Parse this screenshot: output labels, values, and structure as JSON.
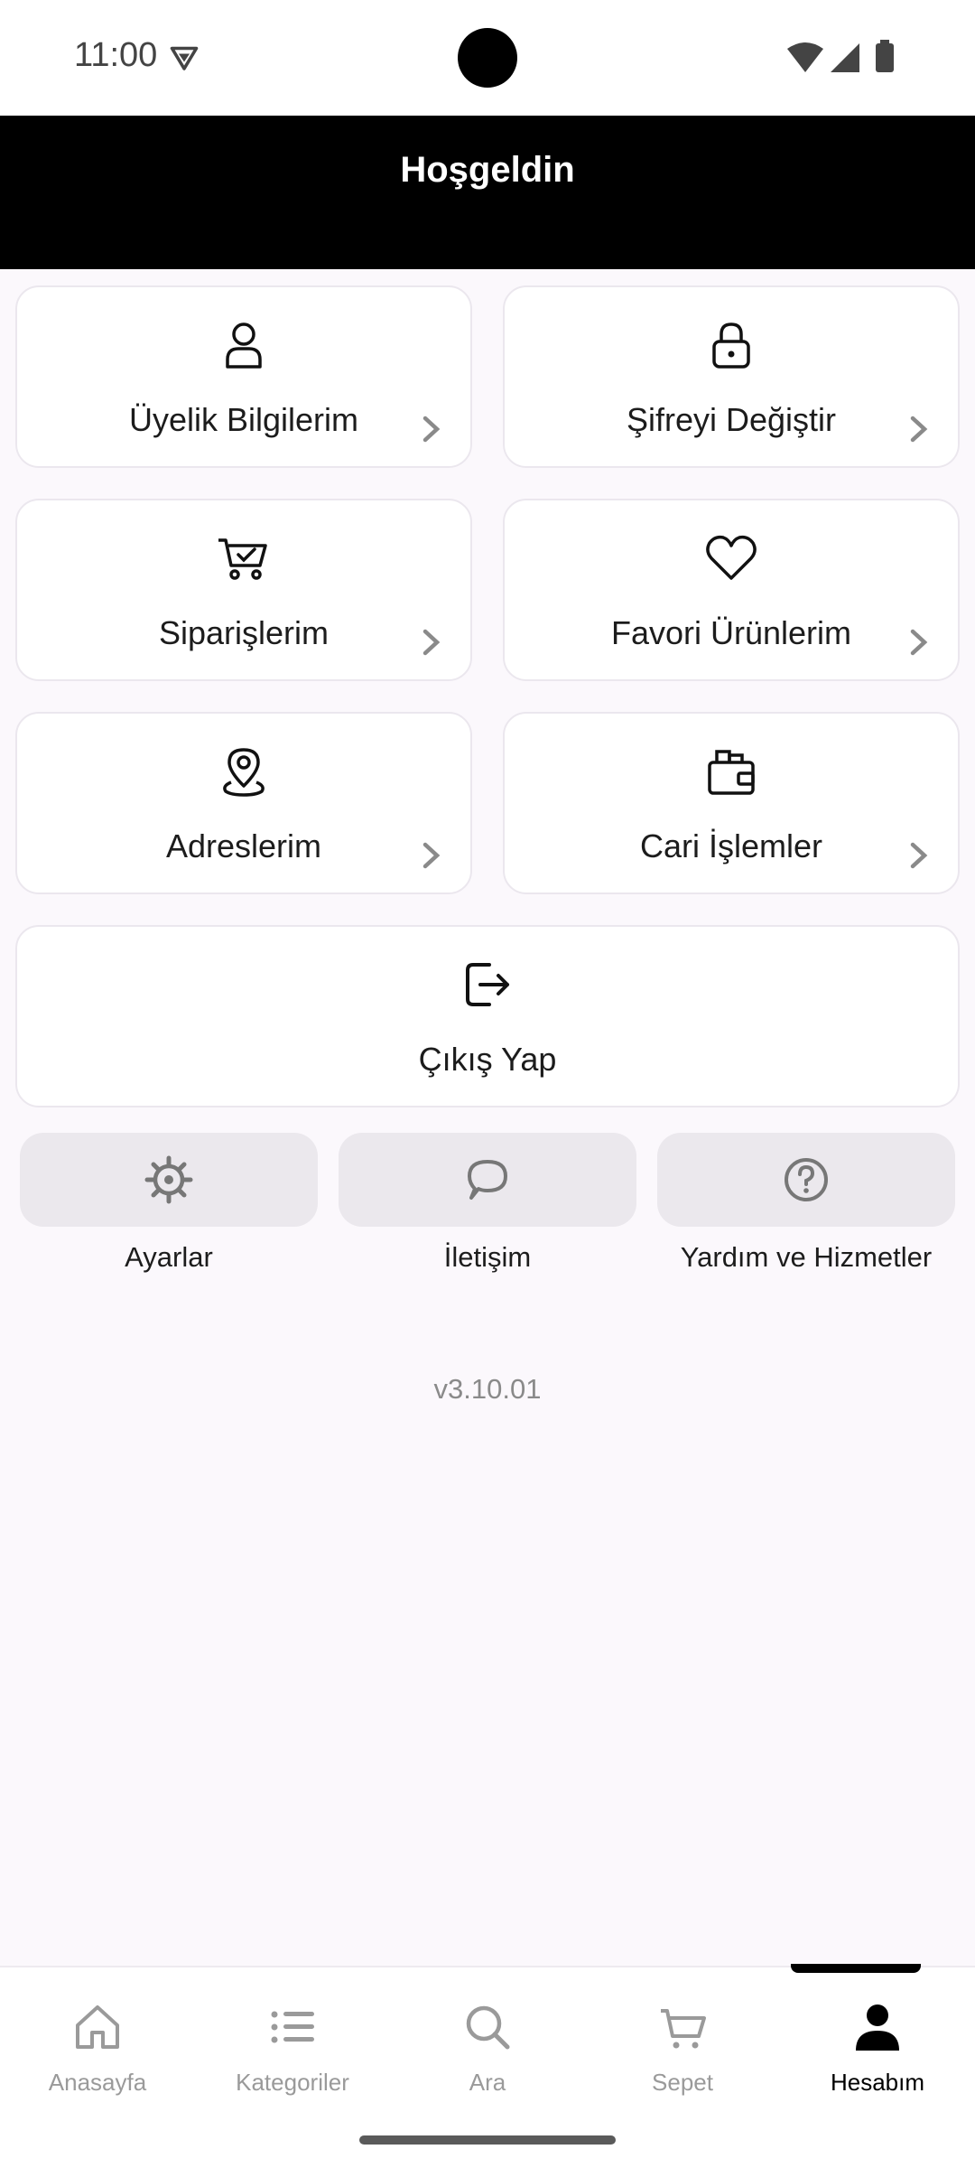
{
  "status_bar": {
    "time": "11:00"
  },
  "header": {
    "title": "Hoşgeldin"
  },
  "menu": {
    "membership": "Üyelik Bilgilerim",
    "change_password": "Şifreyi Değiştir",
    "orders": "Siparişlerim",
    "favorites": "Favori Ürünlerim",
    "addresses": "Adreslerim",
    "current_account": "Cari İşlemler",
    "logout": "Çıkış Yap"
  },
  "quick_actions": {
    "settings": "Ayarlar",
    "contact": "İletişim",
    "help": "Yardım ve Hizmetler"
  },
  "version": "v3.10.01",
  "bottom_nav": {
    "home": "Anasayfa",
    "categories": "Kategoriler",
    "search": "Ara",
    "cart": "Sepet",
    "account": "Hesabım",
    "active": "account"
  },
  "colors": {
    "header_bg": "#000000",
    "page_bg": "#fbf8fc",
    "card_bg": "#ffffff",
    "pill_bg": "#ebe8ed",
    "inactive_nav": "#9a9a9a"
  }
}
